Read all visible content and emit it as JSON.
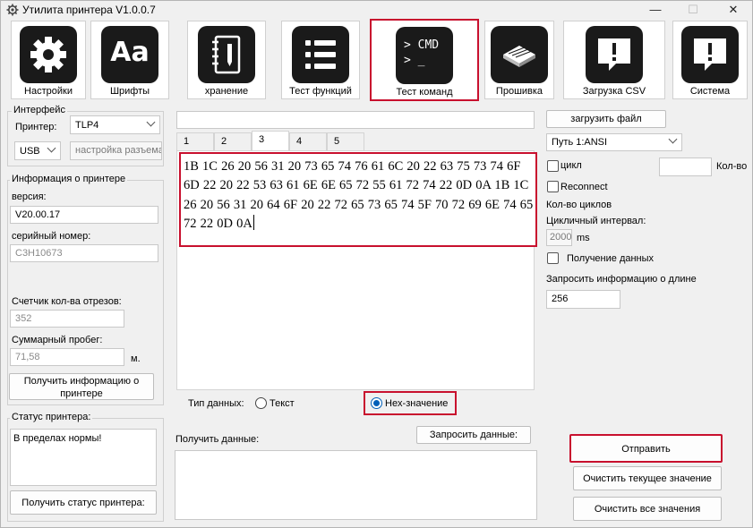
{
  "window": {
    "title": "Утилита принтера  V1.0.0.7",
    "minimize": "—",
    "maximize": "☐",
    "close": "✕"
  },
  "toolbar": [
    {
      "label": "Настройки",
      "icon": "gear-icon"
    },
    {
      "label": "Шрифты",
      "icon": "font-icon",
      "glyph": "Aa"
    },
    {
      "label": "хранение",
      "icon": "notebook-icon"
    },
    {
      "label": "Тест функций",
      "icon": "list-icon"
    },
    {
      "label": "Тест команд",
      "icon": "cmd-icon",
      "glyph": "> CMD\n> _",
      "active": true
    },
    {
      "label": "Прошивка",
      "icon": "chip-icon"
    },
    {
      "label": "Загрузка CSV",
      "icon": "message-alert-icon"
    },
    {
      "label": "Система",
      "icon": "message-alert-icon"
    }
  ],
  "left": {
    "interface": {
      "title": "Интерфейс",
      "printer_label": "Принтер:",
      "printer_value": "TLP4",
      "port_value": "USB",
      "port_settings": "настройка разъема"
    },
    "printer_info": {
      "title": "Информация о принтере",
      "version_label": "версия:",
      "version_value": "V20.00.17",
      "serial_label": "серийный номер:",
      "serial_value": "C3H10673",
      "cut_counter_label": "Счетчик кол-ва отрезов:",
      "cut_counter_value": "352",
      "mileage_label": "Суммарный пробег:",
      "mileage_value": "71,58",
      "mileage_unit": "м.",
      "get_info_button": "Получить информацию о принтере"
    },
    "status": {
      "title": "Статус принтера:",
      "value": "В пределах нормы!",
      "get_status_button": "Получить статус принтера:"
    }
  },
  "center": {
    "command_input": "",
    "tabs": [
      "1",
      "2",
      "3",
      "4",
      "5"
    ],
    "selected_tab": "3",
    "hex_content": "1B 1C 26 20 56 31 20 73 65 74 76 61 6C 20 22 63 75 73 74 6F 6D 22 20 22 53 63 61 6E 6E 65 72 55 61 72 74 22 0D 0A 1B 1C 26 20 56 31 20 64 6F 20 22 72 65 73 65 74 5F 70 72 69 6E 74 65 72 22 0D 0A",
    "data_type_label": "Тип данных:",
    "type_text": "Текст",
    "type_hex": "Hex-значение",
    "receive_label": "Получить данные:",
    "request_button": "Запросить данные:"
  },
  "right": {
    "load_file_button": "загрузить файл",
    "path_value": "Путь 1:ANSI",
    "cycle_label": "цикл",
    "count_label": "Кол-во",
    "count_value": "",
    "reconnect_label": "Reconnect",
    "cycles_label": "Кол-во циклов",
    "interval_label": "Цикличный интервал:",
    "interval_value": "2000",
    "interval_unit": "ms",
    "receive_data_label": "Получение данных",
    "request_len_label": "Запросить информацию о длине",
    "request_len_value": "256",
    "send_button": "Отправить",
    "clear_current_button": "Очистить текущее значение",
    "clear_all_button": "Очистить все значения"
  },
  "colors": {
    "highlight": "#c8102e",
    "radio_accent": "#005fb8",
    "icon_bg": "#1a1a1a"
  }
}
